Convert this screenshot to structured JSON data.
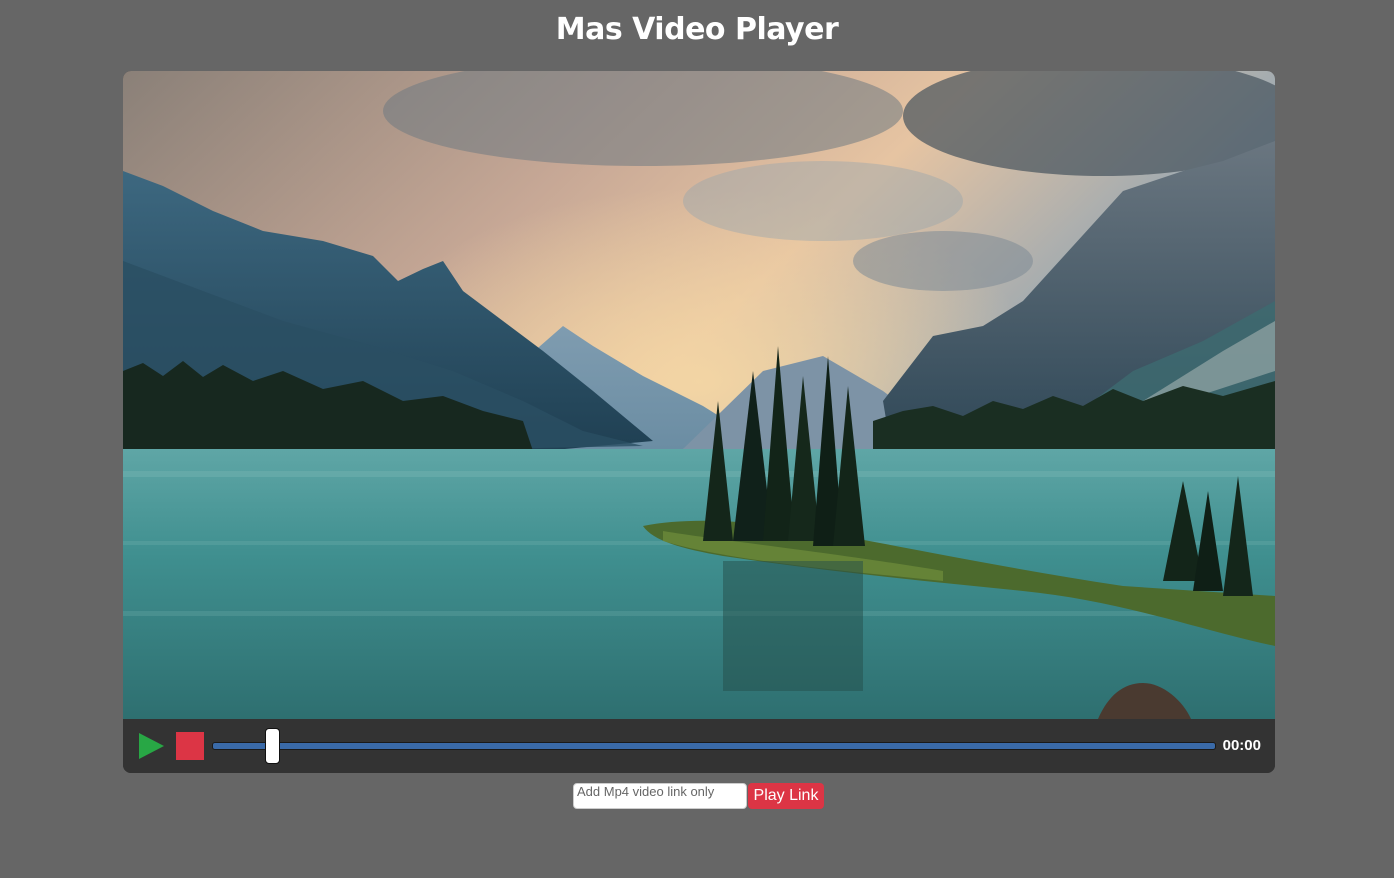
{
  "page": {
    "title": "Mas Video Player",
    "background_color": "#666666"
  },
  "player": {
    "controls": {
      "play_icon": "play-icon",
      "play_color": "#28a745",
      "stop_icon": "stop-icon",
      "stop_color": "#dc3545",
      "seek_progress": 0.06,
      "seek_track_color": "#3a6aa8",
      "time": "00:00"
    }
  },
  "link_form": {
    "input_value": "",
    "input_placeholder": "Add Mp4 video link only",
    "button_label": "Play Link",
    "button_color": "#dc3545"
  }
}
